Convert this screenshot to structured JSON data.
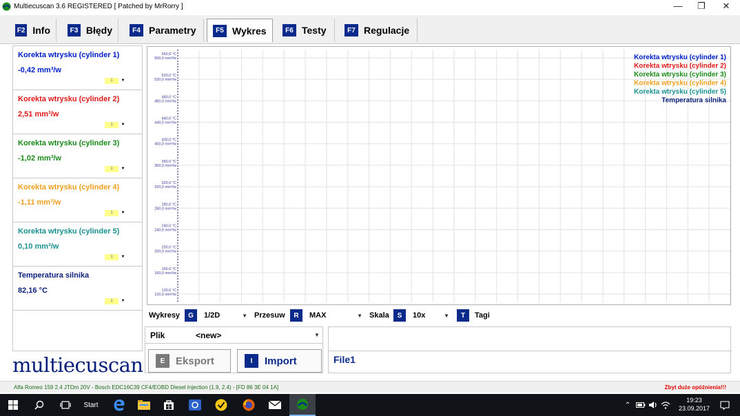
{
  "window": {
    "title": "Multiecuscan 3.6 REGISTERED    [ Patched by MrRorry ]",
    "minimize_glyph": "—",
    "restore_glyph": "❐",
    "close_glyph": "✕"
  },
  "tabs": [
    {
      "key": "F2",
      "label": "Info",
      "active": false
    },
    {
      "key": "F3",
      "label": "Błędy",
      "active": false
    },
    {
      "key": "F4",
      "label": "Parametry",
      "active": false
    },
    {
      "key": "F5",
      "label": "Wykres",
      "active": true
    },
    {
      "key": "F6",
      "label": "Testy",
      "active": false
    },
    {
      "key": "F7",
      "label": "Regulacje",
      "active": false
    }
  ],
  "params": [
    {
      "name": "Korekta wtrysku (cylinder 1)",
      "value": "-0,42 mm³/w",
      "color": "#0020c8",
      "sel": "1"
    },
    {
      "name": "Korekta wtrysku (cylinder 2)",
      "value": "2,51 mm³/w",
      "color": "#e01818",
      "sel": "1"
    },
    {
      "name": "Korekta wtrysku (cylinder 3)",
      "value": "-1,02 mm³/w",
      "color": "#1a8a1a",
      "sel": "1"
    },
    {
      "name": "Korekta wtrysku (cylinder 4)",
      "value": "-1,11 mm³/w",
      "color": "#f0a020",
      "sel": "1"
    },
    {
      "name": "Korekta wtrysku (cylinder 5)",
      "value": "0,10 mm³/w",
      "color": "#1a9090",
      "sel": "1"
    },
    {
      "name": "Temperatura silnika",
      "value": "82,16 °C",
      "color": "#0a1f7a",
      "sel": "1"
    }
  ],
  "chart_data": {
    "type": "line",
    "title": "",
    "xlabel": "",
    "ylabel": "",
    "y_ticks": [
      {
        "c": "560,0 °C",
        "m": "560,0 mm³/w"
      },
      {
        "c": "520,0 °C",
        "m": "520,0 mm³/w"
      },
      {
        "c": "480,0 °C",
        "m": "480,0 mm³/w"
      },
      {
        "c": "440,0 °C",
        "m": "440,0 mm³/w"
      },
      {
        "c": "400,0 °C",
        "m": "400,0 mm³/w"
      },
      {
        "c": "360,0 °C",
        "m": "360,0 mm³/w"
      },
      {
        "c": "320,0 °C",
        "m": "320,0 mm³/w"
      },
      {
        "c": "280,0 °C",
        "m": "280,0 mm³/w"
      },
      {
        "c": "240,0 °C",
        "m": "240,0 mm³/w"
      },
      {
        "c": "200,0 °C",
        "m": "200,0 mm³/w"
      },
      {
        "c": "160,0 °C",
        "m": "160,0 mm³/w"
      },
      {
        "c": "120,0 °C",
        "m": "120,0 mm³/w"
      }
    ],
    "ylim": [
      120,
      560
    ],
    "grid": true,
    "legend_placement": "top-right",
    "series": [
      {
        "name": "Korekta wtrysku (cylinder 1)",
        "color": "#0020c8",
        "values": []
      },
      {
        "name": "Korekta wtrysku (cylinder 2)",
        "color": "#e01818",
        "values": []
      },
      {
        "name": "Korekta wtrysku (cylinder 3)",
        "color": "#1a8a1a",
        "values": []
      },
      {
        "name": "Korekta wtrysku (cylinder 4)",
        "color": "#f0a020",
        "values": []
      },
      {
        "name": "Korekta wtrysku (cylinder 5)",
        "color": "#1a9090",
        "values": []
      },
      {
        "name": "Temperatura silnika",
        "color": "#0a1f7a",
        "values": []
      }
    ]
  },
  "controls": {
    "wykresy_label": "Wykresy",
    "wykresy_key": "G",
    "wykresy_value": "1/2D",
    "przesuw_label": "Przesuw",
    "przesuw_key": "R",
    "przesuw_value": "MAX",
    "skala_label": "Skala",
    "skala_key": "S",
    "skala_value": "10x",
    "tagi_key": "T",
    "tagi_label": "Tagi"
  },
  "file": {
    "plik_label": "Plik",
    "plik_value": "<new>",
    "eksport_key": "E",
    "eksport_label": "Eksport",
    "import_key": "I",
    "import_label": "Import",
    "file_name": "File1"
  },
  "logo_text": "multiecuscan",
  "status": {
    "left": "Alfa Romeo 159 2.4 JTDm 20V - Bosch EDC16C39 CF4/EOBD Diesel Injection (1.9, 2.4) - [FD 86 3E 04 1A]",
    "right": "Zbyt duże opóźnienia!!!"
  },
  "taskbar": {
    "start_label": "Start",
    "time": "19:23",
    "date": "23.09.2017"
  },
  "colors": {
    "accent": "#0a2a8c",
    "eksport_key_bg": "#7a7a7a"
  }
}
